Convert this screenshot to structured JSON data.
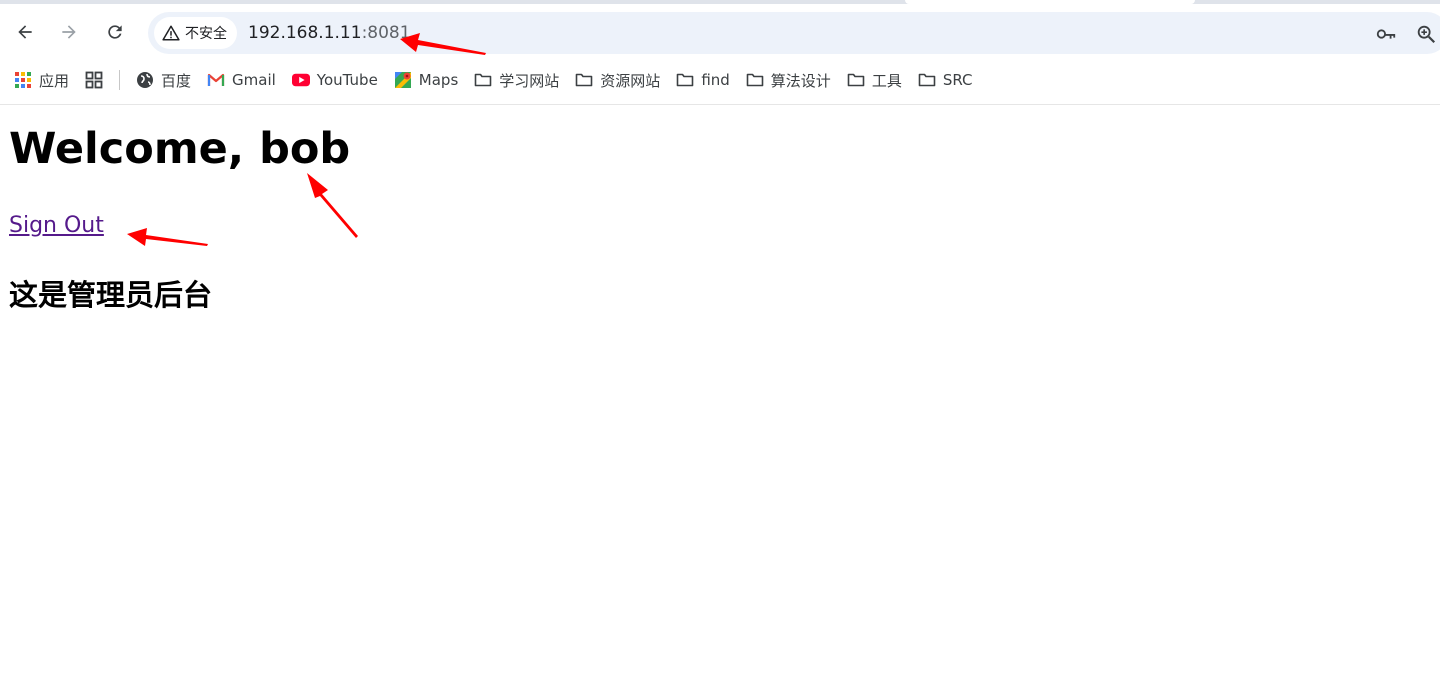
{
  "browser": {
    "security_label": "不安全",
    "url_host": "192.168.1.11",
    "url_port": ":8081",
    "icons": {
      "back": "back-arrow-icon",
      "forward": "forward-arrow-icon",
      "reload": "reload-icon",
      "security": "warning-triangle-icon",
      "password": "key-icon",
      "zoom": "zoom-in-icon"
    }
  },
  "bookmarks": [
    {
      "label": "应用",
      "icon": "apps-grid-icon"
    },
    {
      "label": "",
      "icon": "tab-groups-icon"
    },
    {
      "label": "百度",
      "icon": "globe-icon"
    },
    {
      "label": "Gmail",
      "icon": "gmail-icon"
    },
    {
      "label": "YouTube",
      "icon": "youtube-icon"
    },
    {
      "label": "Maps",
      "icon": "maps-icon"
    },
    {
      "label": "学习网站",
      "icon": "folder-icon"
    },
    {
      "label": "资源网站",
      "icon": "folder-icon"
    },
    {
      "label": "find",
      "icon": "folder-icon"
    },
    {
      "label": "算法设计",
      "icon": "folder-icon"
    },
    {
      "label": "工具",
      "icon": "folder-icon"
    },
    {
      "label": "SRC",
      "icon": "folder-icon"
    }
  ],
  "page": {
    "title": "Welcome, bob",
    "sign_out": "Sign Out",
    "subheading": "这是管理员后台"
  },
  "colors": {
    "link_visited": "#551a8b",
    "omnibox_bg": "#edf2fa",
    "annotation_arrow": "#ff0000"
  }
}
